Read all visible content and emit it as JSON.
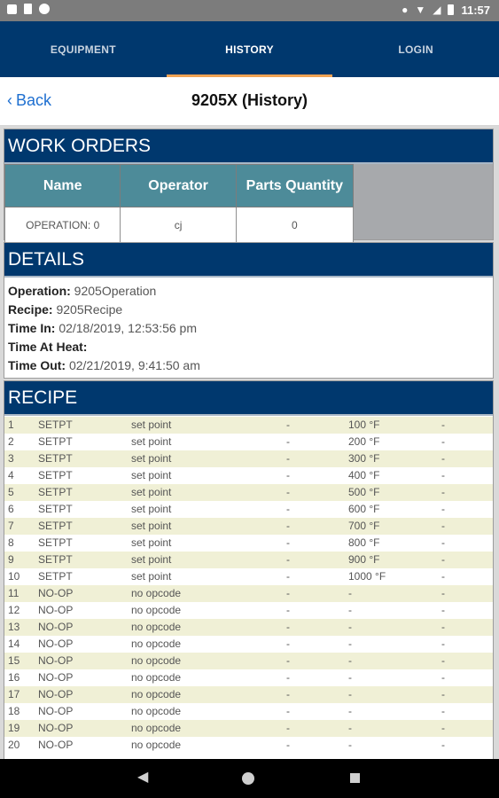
{
  "status_bar": {
    "time": "11:57"
  },
  "nav": {
    "tabs": [
      {
        "label": "EQUIPMENT",
        "active": false
      },
      {
        "label": "HISTORY",
        "active": true
      },
      {
        "label": "LOGIN",
        "active": false
      }
    ]
  },
  "header": {
    "back_label": "Back",
    "title": "9205X (History)"
  },
  "work_orders": {
    "title": "WORK ORDERS",
    "columns": [
      "Name",
      "Operator",
      "Parts Quantity"
    ],
    "row": [
      "OPERATION: 0",
      "cj",
      "0"
    ]
  },
  "details": {
    "title": "DETAILS",
    "fields": [
      {
        "label": "Operation:",
        "value": "9205Operation"
      },
      {
        "label": "Recipe:",
        "value": "9205Recipe"
      },
      {
        "label": "Time In:",
        "value": "02/18/2019, 12:53:56 pm"
      },
      {
        "label": "Time At Heat:",
        "value": ""
      },
      {
        "label": "Time Out:",
        "value": "02/21/2019, 9:41:50 am"
      }
    ]
  },
  "recipe": {
    "title": "RECIPE",
    "rows": [
      [
        "1",
        "SETPT",
        "set point",
        "-",
        "100 °F",
        "-"
      ],
      [
        "2",
        "SETPT",
        "set point",
        "-",
        "200 °F",
        "-"
      ],
      [
        "3",
        "SETPT",
        "set point",
        "-",
        "300 °F",
        "-"
      ],
      [
        "4",
        "SETPT",
        "set point",
        "-",
        "400 °F",
        "-"
      ],
      [
        "5",
        "SETPT",
        "set point",
        "-",
        "500 °F",
        "-"
      ],
      [
        "6",
        "SETPT",
        "set point",
        "-",
        "600 °F",
        "-"
      ],
      [
        "7",
        "SETPT",
        "set point",
        "-",
        "700 °F",
        "-"
      ],
      [
        "8",
        "SETPT",
        "set point",
        "-",
        "800 °F",
        "-"
      ],
      [
        "9",
        "SETPT",
        "set point",
        "-",
        "900 °F",
        "-"
      ],
      [
        "10",
        "SETPT",
        "set point",
        "-",
        "1000 °F",
        "-"
      ],
      [
        "11",
        "NO-OP",
        "no opcode",
        "-",
        "-",
        "-"
      ],
      [
        "12",
        "NO-OP",
        "no opcode",
        "-",
        "-",
        "-"
      ],
      [
        "13",
        "NO-OP",
        "no opcode",
        "-",
        "-",
        "-"
      ],
      [
        "14",
        "NO-OP",
        "no opcode",
        "-",
        "-",
        "-"
      ],
      [
        "15",
        "NO-OP",
        "no opcode",
        "-",
        "-",
        "-"
      ],
      [
        "16",
        "NO-OP",
        "no opcode",
        "-",
        "-",
        "-"
      ],
      [
        "17",
        "NO-OP",
        "no opcode",
        "-",
        "-",
        "-"
      ],
      [
        "18",
        "NO-OP",
        "no opcode",
        "-",
        "-",
        "-"
      ],
      [
        "19",
        "NO-OP",
        "no opcode",
        "-",
        "-",
        "-"
      ],
      [
        "20",
        "NO-OP",
        "no opcode",
        "-",
        "-",
        "-"
      ]
    ]
  },
  "colors": {
    "nav_bg": "#00386e",
    "tab_indicator": "#f0a354",
    "table_header": "#4d8b99",
    "row_stripe": "#f0f0d6",
    "link": "#1e6fd0"
  }
}
